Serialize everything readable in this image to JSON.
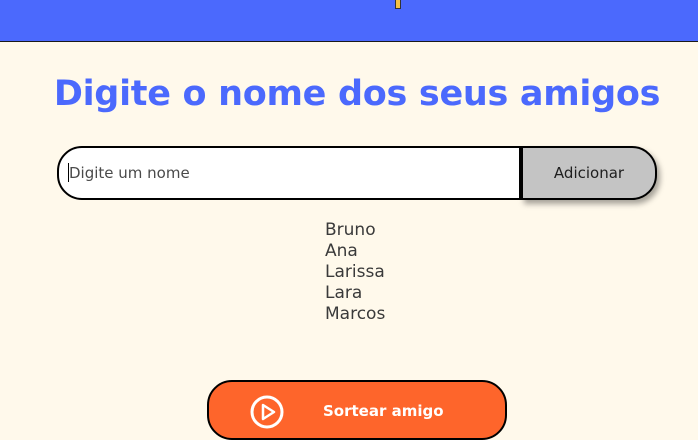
{
  "header": {
    "color": "#4B69FD"
  },
  "main": {
    "title": "Digite o nome dos seus amigos",
    "input": {
      "placeholder": "Digite um nome",
      "value": ""
    },
    "add_button_label": "Adicionar",
    "friends": [
      "Bruno",
      "Ana",
      "Larissa",
      "Lara",
      "Marcos"
    ],
    "draw_button": {
      "label": "Sortear amigo",
      "icon": "play-circle-icon",
      "color": "#FE652B"
    }
  },
  "colors": {
    "background": "#FFF9EB",
    "title": "#4B69FD",
    "add_button": "#C4C4C4",
    "draw_button": "#FE652B"
  }
}
